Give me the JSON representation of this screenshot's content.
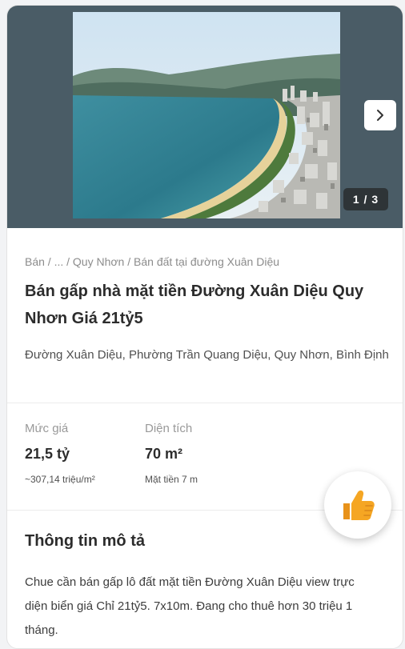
{
  "gallery": {
    "counter": "1 / 3",
    "next_icon": "chevron-right-icon"
  },
  "listing": {
    "breadcrumb": "Bán / ... / Quy Nhơn / Bán đất tại đường Xuân Diệu",
    "title": "Bán gấp nhà mặt tiền Đường Xuân Diệu Quy Nhơn Giá 21tỷ5",
    "address": "Đường Xuân Diệu, Phường Trần Quang Diệu, Quy Nhơn, Bình Định"
  },
  "price": {
    "label": "Mức giá",
    "value": "21,5 tỷ",
    "sub": "~307,14 triệu/m²"
  },
  "area": {
    "label": "Diện tích",
    "value": "70 m²",
    "sub": "Mặt tiền 7 m"
  },
  "description": {
    "title": "Thông tin mô tả",
    "text": "Chue cần bán gấp lô đất mặt tiền Đường Xuân Diệu view trực diện biển giá Chỉ 21tỷ5. 7x10m. Đang cho thuê hơn 30 triệu 1 tháng."
  },
  "like_button": {
    "icon": "thumbs-up-icon"
  },
  "colors": {
    "background": "#f2f3f5",
    "gallery_bg": "#4a5c66",
    "text_primary": "#2c2c2c",
    "text_muted": "#8c8c8c",
    "thumb": "#f5a623"
  }
}
